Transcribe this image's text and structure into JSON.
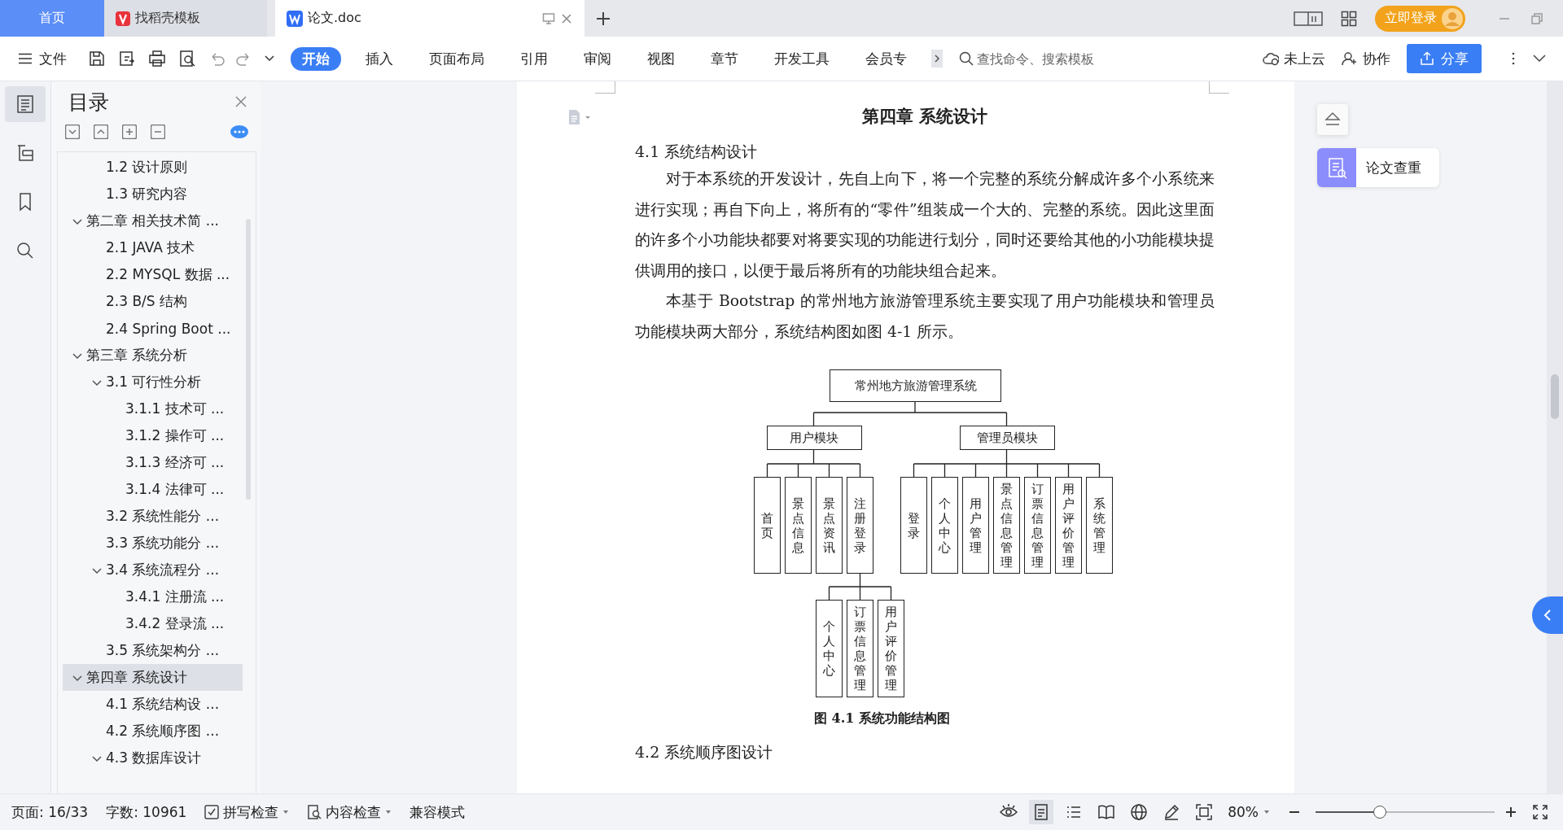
{
  "tabs": [
    {
      "label": "首页",
      "kind": "home",
      "selected": false
    },
    {
      "label": "找稻壳模板",
      "kind": "app",
      "selected": false
    },
    {
      "label": "论文.doc",
      "kind": "doc",
      "selected": true
    }
  ],
  "login_button": "立即登录",
  "toolbar": {
    "file_menu": "文件",
    "ribbon_tabs": [
      {
        "label": "开始",
        "selected": true
      },
      {
        "label": "插入",
        "selected": false
      },
      {
        "label": "页面布局",
        "selected": false
      },
      {
        "label": "引用",
        "selected": false
      },
      {
        "label": "审阅",
        "selected": false
      },
      {
        "label": "视图",
        "selected": false
      },
      {
        "label": "章节",
        "selected": false
      },
      {
        "label": "开发工具",
        "selected": false
      },
      {
        "label": "会员专",
        "selected": false
      }
    ],
    "search": {
      "placeholder": "查找命令、搜索模板"
    },
    "cloud": "未上云",
    "collaborate": "协作",
    "share": "分享"
  },
  "sidebar": {
    "title": "目录",
    "toc": [
      {
        "children": [
          {
            "label": "1.2  设计原则",
            "selected": false
          },
          {
            "label": "1.3  研究内容",
            "selected": false
          }
        ]
      },
      {
        "label": "第二章  相关技术简 ...",
        "selected": false,
        "expanded": true,
        "children": [
          {
            "label": "2.1 JAVA 技术",
            "selected": false
          },
          {
            "label": "2.2 MYSQL 数据 ...",
            "selected": false
          },
          {
            "label": "2.3 B/S 结构",
            "selected": false
          },
          {
            "label": "2.4 Spring Boot  ...",
            "selected": false
          }
        ]
      },
      {
        "label": "第三章  系统分析",
        "selected": false,
        "expanded": true,
        "children": [
          {
            "label": "3.1 可行性分析",
            "selected": false,
            "expanded": true,
            "children": [
              {
                "label": "3.1.1 技术可 ...",
                "selected": false
              },
              {
                "label": "3.1.2  操作可 ...",
                "selected": false
              },
              {
                "label": "3.1.3  经济可 ...",
                "selected": false
              },
              {
                "label": "3.1.4  法律可 ...",
                "selected": false
              }
            ]
          },
          {
            "label": "3.2 系统性能分 ...",
            "selected": false
          },
          {
            "label": "3.3 系统功能分 ...",
            "selected": false
          },
          {
            "label": "3.4 系统流程分 ...",
            "selected": false,
            "expanded": true,
            "children": [
              {
                "label": "3.4.1 注册流 ...",
                "selected": false
              },
              {
                "label": "3.4.2  登录流 ...",
                "selected": false
              }
            ]
          },
          {
            "label": "3.5 系统架构分 ...",
            "selected": false
          }
        ]
      },
      {
        "label": "第四章  系统设计",
        "selected": true,
        "expanded": true,
        "children": [
          {
            "label": "4.1 系统结构设 ...",
            "selected": false
          },
          {
            "label": "4.2 系统顺序图 ...",
            "selected": false
          },
          {
            "label": "4.3 数据库设计",
            "selected": false,
            "expanded": true
          }
        ]
      }
    ]
  },
  "document": {
    "chapter_title": "第四章  系统设计",
    "section_title": "4.1 系统结构设计",
    "paragraphs": [
      "对于本系统的开发设计，先自上向下，将一个完整的系统分解成许多个小系统来进行实现；再自下向上，将所有的“零件”组装成一个大的、完整的系统。因此这里面的许多个小功能块都要对将要实现的功能进行划分，同时还要给其他的小功能模块提供调用的接口，以便于最后将所有的功能块组合起来。",
      "本基于 Bootstrap 的常州地方旅游管理系统主要实现了用户功能模块和管理员功能模块两大部分，系统结构图如图 4-1 所示。"
    ],
    "diagram": {
      "label": "常州地方旅游管理系统",
      "children": [
        {
          "label": "用户模块",
          "children": [
            {
              "label": "首页"
            },
            {
              "label": "景点信息"
            },
            {
              "label": "景点资讯"
            },
            {
              "label": "注册登录",
              "children": [
                {
                  "label": "个人中心"
                },
                {
                  "label": "订票信息管理"
                },
                {
                  "label": "用户评价管理"
                }
              ]
            }
          ]
        },
        {
          "label": "管理员模块",
          "children": [
            {
              "label": "登录"
            },
            {
              "label": "个人中心"
            },
            {
              "label": "用户管理"
            },
            {
              "label": "景点信息管理"
            },
            {
              "label": "订票信息管理"
            },
            {
              "label": "用户评价管理"
            },
            {
              "label": "系统管理"
            }
          ]
        }
      ]
    },
    "caption": "图 4.1  系统功能结构图",
    "next_section_title": "4.2 系统顺序图设计"
  },
  "side_panel": {
    "plagiarism_check": "论文查重"
  },
  "status_bar": {
    "page": "页面: 16/33",
    "word_count": "字数: 10961",
    "spell_check": "拼写检查",
    "content_check": "内容检查",
    "compat_mode": "兼容模式",
    "zoom": "80%",
    "zoom_slider": {
      "level": 0.36
    }
  }
}
